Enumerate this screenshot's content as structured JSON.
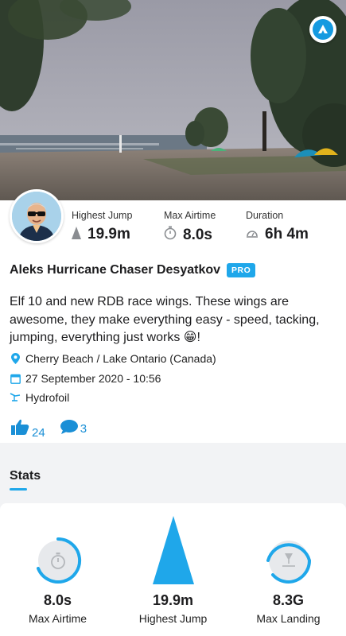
{
  "header": {
    "brand_icon": "kite-app-logo-icon"
  },
  "session": {
    "highest_jump_label": "Highest Jump",
    "highest_jump_value": "19.9m",
    "max_airtime_label": "Max Airtime",
    "max_airtime_value": "8.0s",
    "duration_label": "Duration",
    "duration_value": "6h 4m"
  },
  "rider": {
    "name": "Aleks Hurricane Chaser Desyatkov",
    "badge": "PRO"
  },
  "post": {
    "description": "Elf 10 and new RDB race wings. These wings are awesome, they make everything easy - speed, tacking, jumping, everything just works 😁!",
    "location": "Cherry Beach / Lake Ontario (Canada)",
    "date": "27 September 2020 - 10:56",
    "sport": "Hydrofoil",
    "likes": "24",
    "comments": "3"
  },
  "tabs": {
    "stats_label": "Stats"
  },
  "stats": [
    {
      "value": "8.0s",
      "label": "Max Airtime"
    },
    {
      "value": "19.9m",
      "label": "Highest Jump"
    },
    {
      "value": "8.3G",
      "label": "Max Landing"
    }
  ],
  "colors": {
    "accent": "#1fa7ea",
    "link": "#1a8fd6"
  }
}
